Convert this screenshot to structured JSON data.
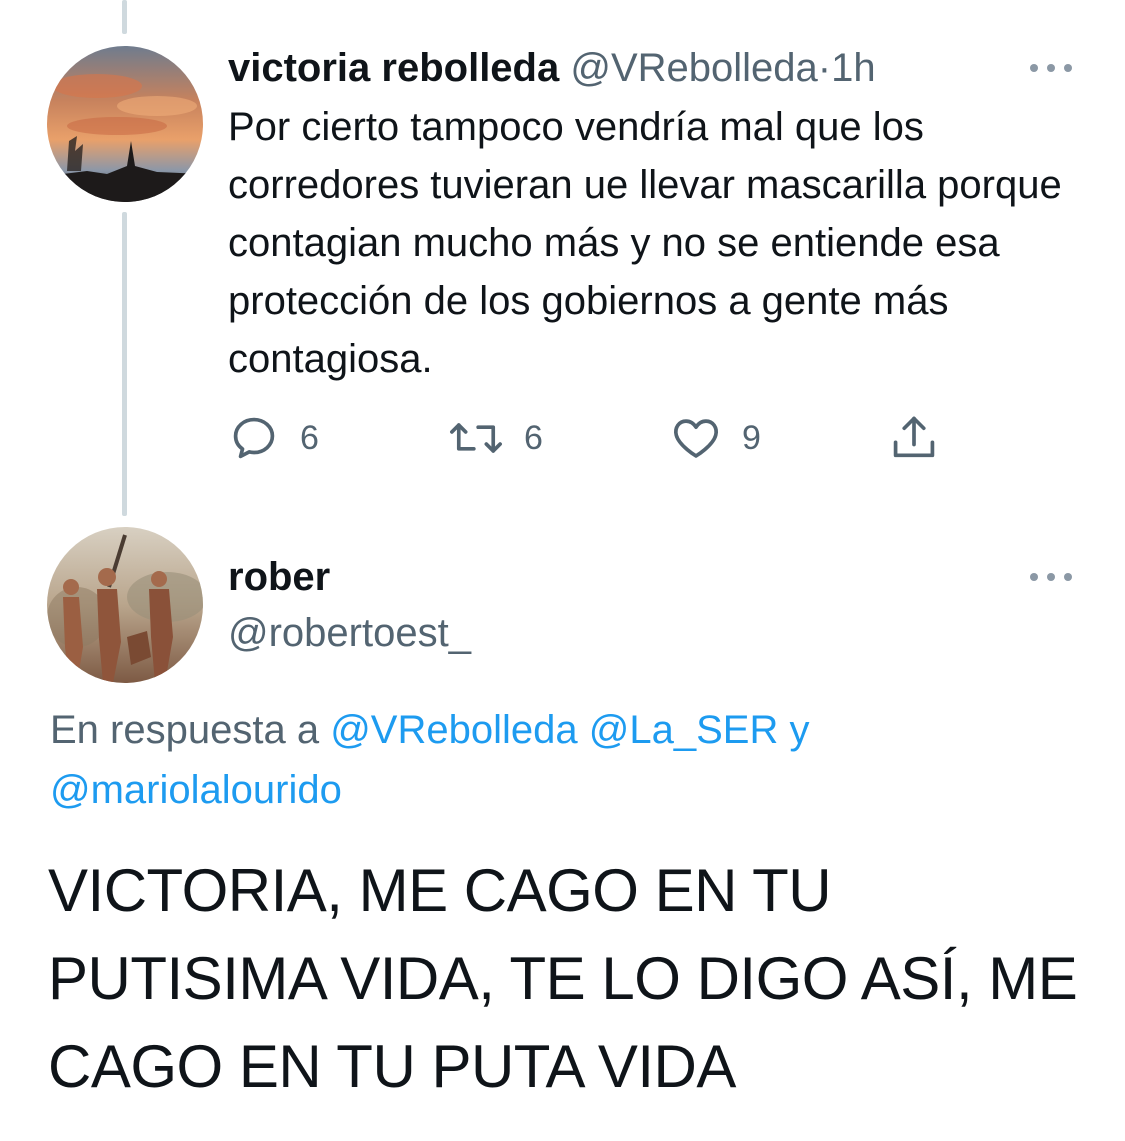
{
  "tweet1": {
    "author_name": "victoria rebolleda",
    "author_handle": "@VRebolleda",
    "separator": "·",
    "time": "1h",
    "text": "Por cierto tampoco vendría mal que los corredores tuvieran ue llevar mascarilla porque contagian mucho más y no se entiende esa protección de los gobiernos a gente más contagiosa.",
    "replies": "6",
    "retweets": "6",
    "likes": "9"
  },
  "tweet2": {
    "author_name": "rober",
    "author_handle": "@robertoest_",
    "reply_prefix": "En respuesta a",
    "reply_mentions": [
      "@VRebolleda",
      "@La_SER",
      "@mariolalourido"
    ],
    "reply_conjunction": "y",
    "text": "VICTORIA, ME CAGO EN TU PUTISIMA VIDA, TE LO DIGO ASÍ, ME CAGO EN TU PUTA VIDA"
  },
  "icons": {
    "reply": "reply-bubble-icon",
    "retweet": "retweet-icon",
    "like": "heart-icon",
    "share": "share-icon",
    "more": "more-dots-icon"
  },
  "colors": {
    "text": "#0f1419",
    "secondary": "#536471",
    "link": "#1d9bf0",
    "thread_line": "#cfd9de"
  }
}
